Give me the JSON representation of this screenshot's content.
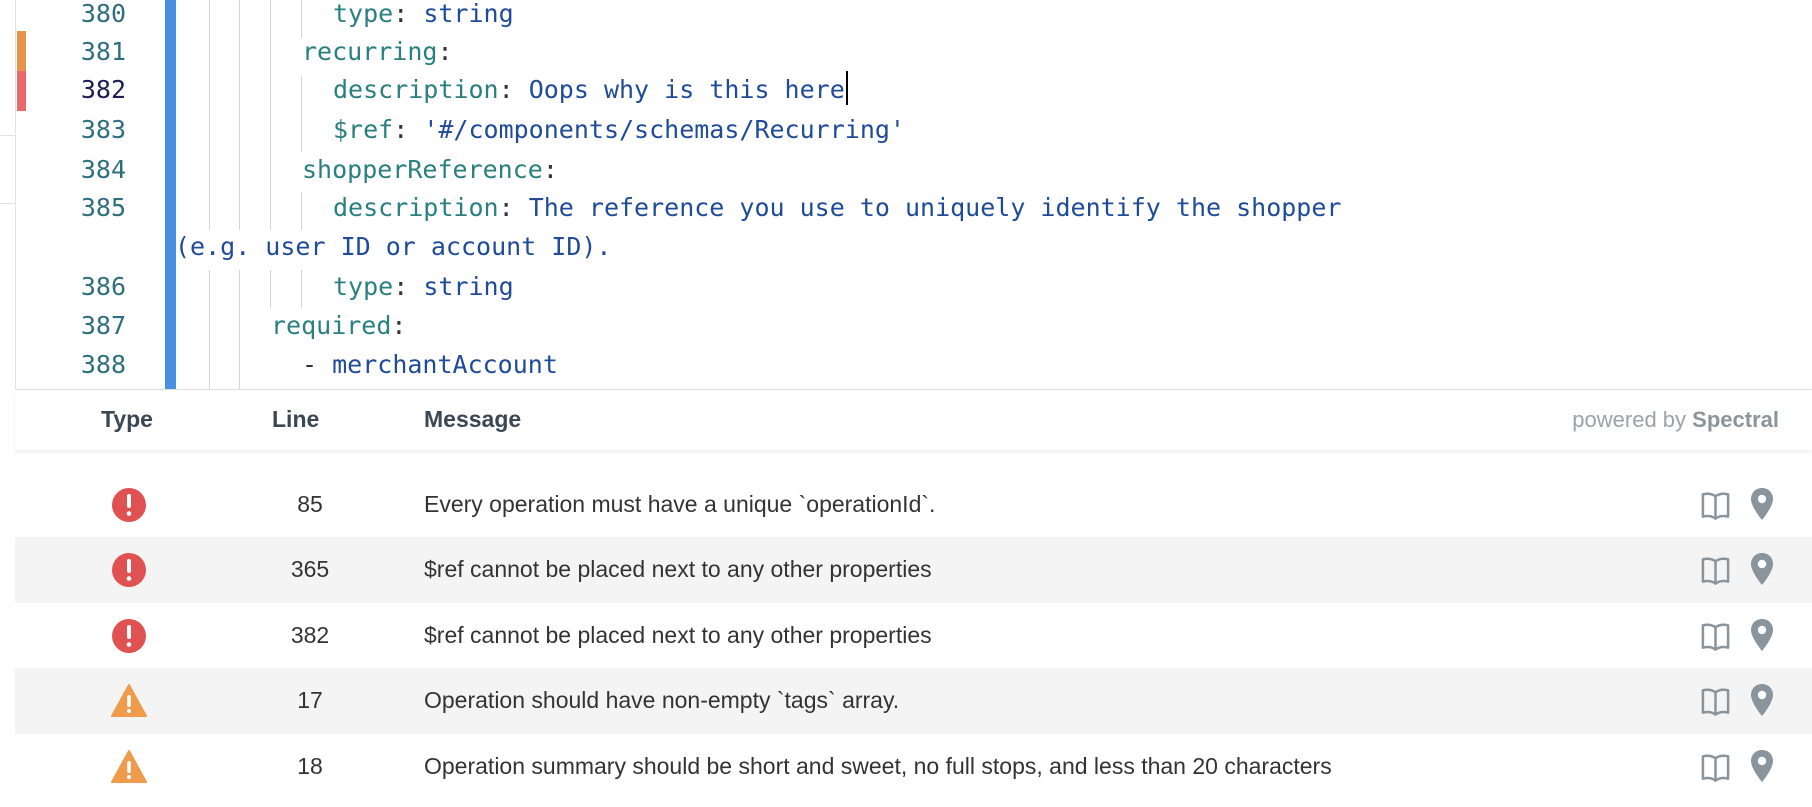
{
  "editor": {
    "lines": [
      {
        "num": "380",
        "key": "type",
        "sep": ": ",
        "value": "string"
      },
      {
        "num": "381",
        "key": "recurring",
        "sep": ":",
        "value": ""
      },
      {
        "num": "382",
        "key": "description",
        "sep": ": ",
        "value": "Oops why is this here"
      },
      {
        "num": "383",
        "key": "$ref",
        "sep": ": ",
        "value": "'#/components/schemas/Recurring'"
      },
      {
        "num": "384",
        "key": "shopperReference",
        "sep": ":",
        "value": ""
      },
      {
        "num": "385",
        "key": "description",
        "sep": ": ",
        "value": "The reference you use to uniquely identify the shopper"
      },
      {
        "num": "",
        "key": "",
        "sep": "",
        "value": "(e.g. user ID or account ID)."
      },
      {
        "num": "386",
        "key": "type",
        "sep": ": ",
        "value": "string"
      },
      {
        "num": "387",
        "key": "required",
        "sep": ":",
        "value": ""
      },
      {
        "num": "388",
        "key": "",
        "sep": "- ",
        "value": "merchantAccount"
      }
    ],
    "gutter_marks": {
      "warning_color": "#e8934a",
      "error_color": "#e8696b"
    }
  },
  "problems": {
    "headers": {
      "type": "Type",
      "line": "Line",
      "message": "Message"
    },
    "powered_by": {
      "prefix": "powered by",
      "brand": "Spectral"
    },
    "rows": [
      {
        "type": "error",
        "line": "85",
        "message": "Every operation must have a unique `operationId`."
      },
      {
        "type": "error",
        "line": "365",
        "message": "$ref cannot be placed next to any other properties"
      },
      {
        "type": "error",
        "line": "382",
        "message": "$ref cannot be placed next to any other properties"
      },
      {
        "type": "warning",
        "line": "17",
        "message": "Operation should have non-empty `tags` array."
      },
      {
        "type": "warning",
        "line": "18",
        "message": "Operation summary should be short and sweet, no full stops, and less than 20 characters"
      }
    ],
    "icons": {
      "error": "error-circle-icon",
      "warning": "warning-triangle-icon",
      "docs": "book-icon",
      "locate": "map-pin-icon"
    },
    "colors": {
      "error": "#e05252",
      "warning": "#ee9b4c",
      "action": "#8a949c"
    }
  }
}
